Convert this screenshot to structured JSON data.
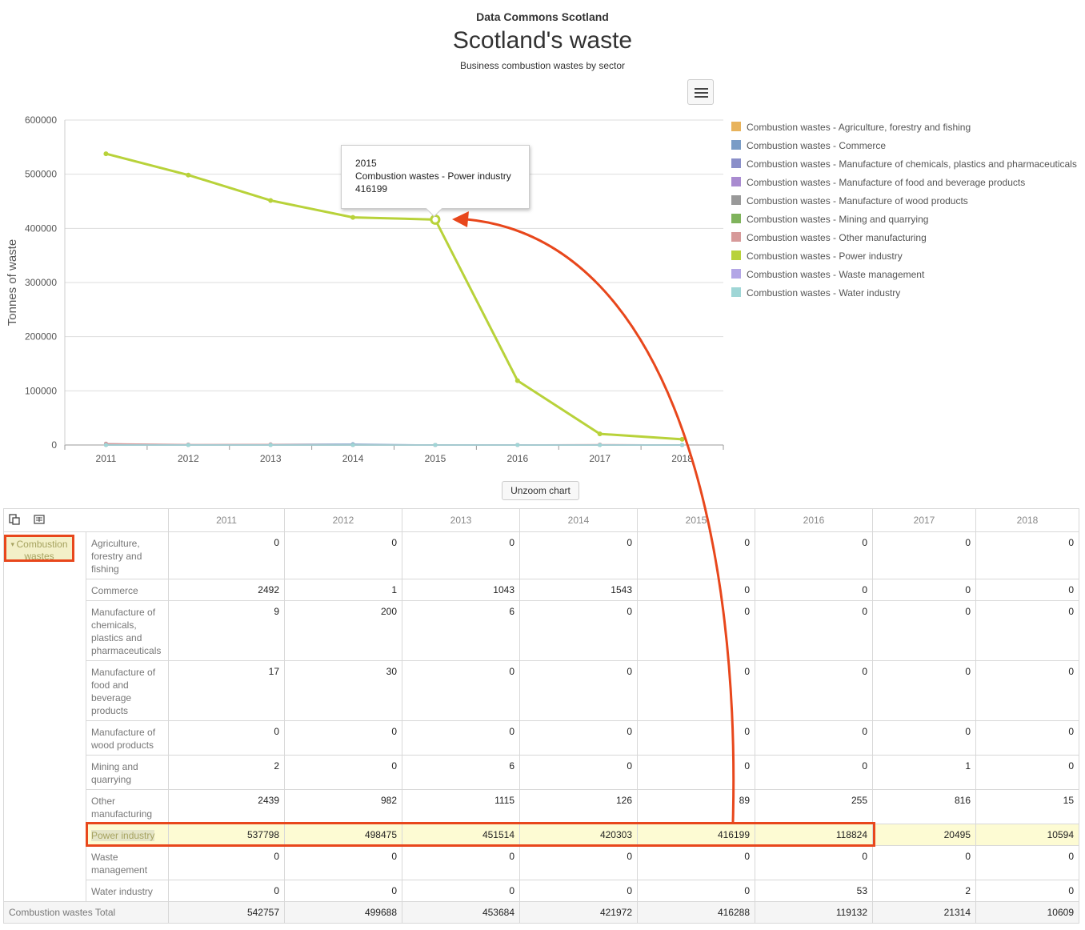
{
  "header": {
    "site_title": "Data Commons Scotland",
    "title": "Scotland's waste",
    "subtitle": "Business combustion wastes by sector"
  },
  "chart_data": {
    "type": "line",
    "ylabel": "Tonnes of waste",
    "x": [
      "2011",
      "2012",
      "2013",
      "2014",
      "2015",
      "2016",
      "2017",
      "2018"
    ],
    "ylim": [
      0,
      600000
    ],
    "yticks": [
      "0",
      "100000",
      "200000",
      "300000",
      "400000",
      "500000",
      "600000"
    ],
    "grid": true,
    "legend_position": "right",
    "series": [
      {
        "name": "Combustion wastes - Agriculture, forestry and fishing",
        "color": "#e8b35c",
        "values": [
          0,
          0,
          0,
          0,
          0,
          0,
          0,
          0
        ]
      },
      {
        "name": "Combustion wastes - Commerce",
        "color": "#7a9cc6",
        "values": [
          2492,
          1,
          1043,
          1543,
          0,
          0,
          0,
          0
        ]
      },
      {
        "name": "Combustion wastes - Manufacture of chemicals, plastics and pharmaceuticals",
        "color": "#8a8fc9",
        "values": [
          9,
          200,
          6,
          0,
          0,
          0,
          0,
          0
        ]
      },
      {
        "name": "Combustion wastes - Manufacture of food and beverage products",
        "color": "#a98bd0",
        "values": [
          17,
          30,
          0,
          0,
          0,
          0,
          0,
          0
        ]
      },
      {
        "name": "Combustion wastes - Manufacture of wood products",
        "color": "#999999",
        "values": [
          0,
          0,
          0,
          0,
          0,
          0,
          0,
          0
        ]
      },
      {
        "name": "Combustion wastes - Mining and quarrying",
        "color": "#7fb35c",
        "values": [
          2,
          0,
          6,
          0,
          0,
          0,
          1,
          0
        ]
      },
      {
        "name": "Combustion wastes - Other manufacturing",
        "color": "#d79a9a",
        "values": [
          2439,
          982,
          1115,
          126,
          89,
          255,
          816,
          15
        ]
      },
      {
        "name": "Combustion wastes - Power industry",
        "color": "#b8d23a",
        "values": [
          537798,
          498475,
          451514,
          420303,
          416199,
          118824,
          20495,
          10594
        ]
      },
      {
        "name": "Combustion wastes - Waste management",
        "color": "#b3a6e6",
        "values": [
          0,
          0,
          0,
          0,
          0,
          0,
          0,
          0
        ]
      },
      {
        "name": "Combustion wastes - Water industry",
        "color": "#9fd6d6",
        "values": [
          0,
          0,
          0,
          0,
          0,
          53,
          2,
          0
        ]
      }
    ]
  },
  "tooltip": {
    "year": "2015",
    "series": "Combustion wastes - Power industry",
    "value": "416199"
  },
  "unzoom_label": "Unzoom chart",
  "table": {
    "years": [
      "2011",
      "2012",
      "2013",
      "2014",
      "2015",
      "2016",
      "2017",
      "2018"
    ],
    "group_label": "Combustion wastes",
    "rows": [
      {
        "label": "Agriculture, forestry and fishing",
        "values": [
          "0",
          "0",
          "0",
          "0",
          "0",
          "0",
          "0",
          "0"
        ]
      },
      {
        "label": "Commerce",
        "values": [
          "2492",
          "1",
          "1043",
          "1543",
          "0",
          "0",
          "0",
          "0"
        ]
      },
      {
        "label": "Manufacture of chemicals, plastics and pharmaceuticals",
        "values": [
          "9",
          "200",
          "6",
          "0",
          "0",
          "0",
          "0",
          "0"
        ]
      },
      {
        "label": "Manufacture of food and beverage products",
        "values": [
          "17",
          "30",
          "0",
          "0",
          "0",
          "0",
          "0",
          "0"
        ]
      },
      {
        "label": "Manufacture of wood products",
        "values": [
          "0",
          "0",
          "0",
          "0",
          "0",
          "0",
          "0",
          "0"
        ]
      },
      {
        "label": "Mining and quarrying",
        "values": [
          "2",
          "0",
          "6",
          "0",
          "0",
          "0",
          "1",
          "0"
        ]
      },
      {
        "label": "Other manufacturing",
        "values": [
          "2439",
          "982",
          "1115",
          "126",
          "89",
          "255",
          "816",
          "15"
        ]
      },
      {
        "label": "Power industry",
        "values": [
          "537798",
          "498475",
          "451514",
          "420303",
          "416199",
          "118824",
          "20495",
          "10594"
        ]
      },
      {
        "label": "Waste management",
        "values": [
          "0",
          "0",
          "0",
          "0",
          "0",
          "0",
          "0",
          "0"
        ]
      },
      {
        "label": "Water industry",
        "values": [
          "0",
          "0",
          "0",
          "0",
          "0",
          "53",
          "2",
          "0"
        ]
      }
    ],
    "total_label": "Combustion wastes Total",
    "totals": [
      "542757",
      "499688",
      "453684",
      "421972",
      "416288",
      "119132",
      "21314",
      "10609"
    ]
  }
}
